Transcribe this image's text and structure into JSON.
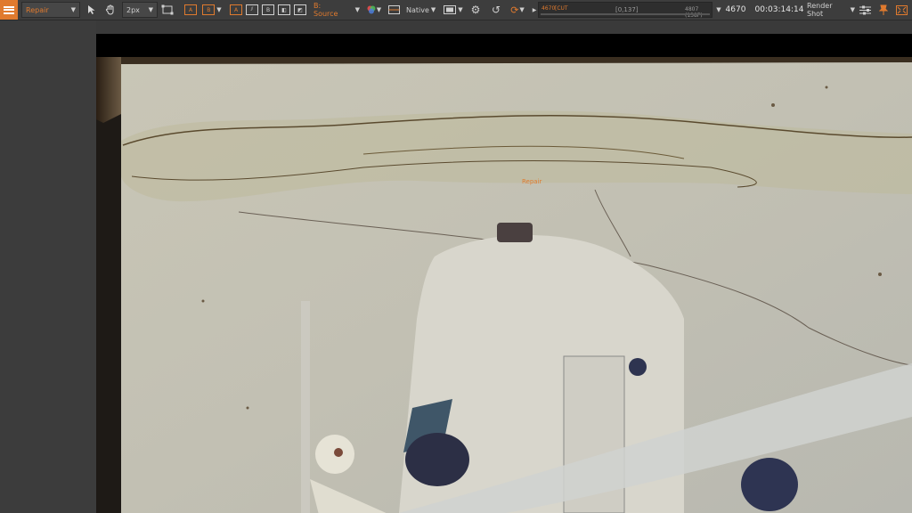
{
  "toolbar": {
    "tool_mode": "Repair",
    "brush_size": "2px",
    "source_label": "B: Source",
    "resolution": "Native",
    "timeline_range": "[0,137]",
    "timeline_start_label": "4670",
    "timeline_cut_label": "[CUT",
    "frame_info": "4807 (138F)",
    "current_frame": "4670",
    "timecode": "00:03:14:14",
    "render_label": "Render Shot"
  },
  "viewer": {
    "overlay_label": "Repair"
  },
  "colors": {
    "accent": "#e07a2e",
    "toolbar_bg": "#3d3d3d",
    "panel_bg": "#3c3c3c",
    "viewer_bg": "#000000"
  }
}
